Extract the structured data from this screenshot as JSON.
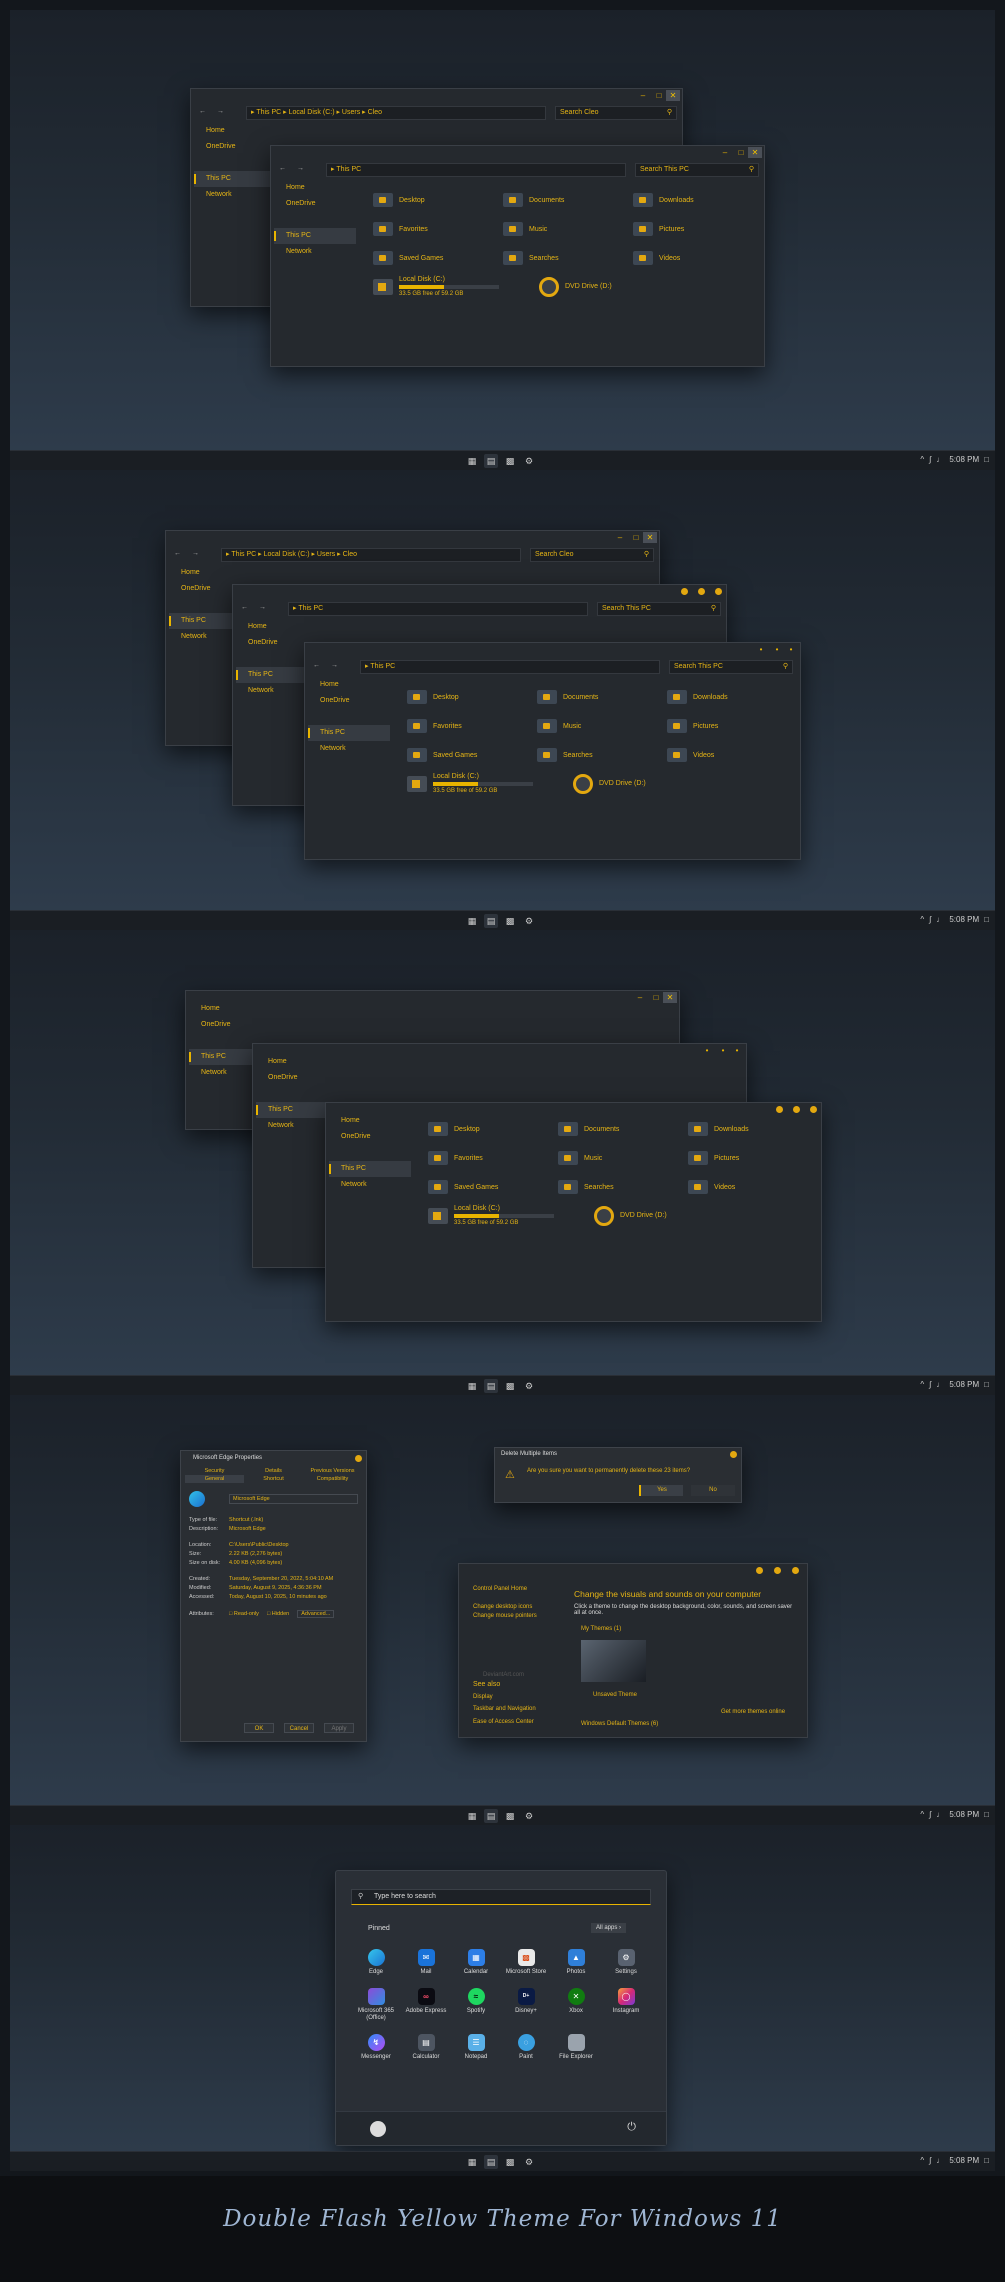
{
  "explorer": {
    "back": "←",
    "fwd": "→",
    "min": "–",
    "max": "□",
    "close": "✕",
    "path_long": "▸ This PC ▸ Local Disk (C:) ▸ Users ▸ Cleo",
    "path_short": "▸ This PC",
    "search_cleo": "Search Cleo",
    "search_pc": "Search This PC",
    "nav_home": "Home",
    "nav_onedrive": "OneDrive",
    "nav_thispc": "This PC",
    "nav_network": "Network",
    "folders": [
      "Desktop",
      "Documents",
      "Downloads",
      "Favorites",
      "Music",
      "Pictures",
      "Saved Games",
      "Searches",
      "Videos"
    ],
    "local_disk": "Local Disk (C:)",
    "local_disk_free": "33.5 GB free of 59.2 GB",
    "local_disk_used_fraction": 0.43,
    "dvd": "DVD Drive (D:)"
  },
  "taskbar": {
    "icons": [
      "taskview-icon",
      "explorer-icon",
      "store-icon",
      "settings-icon"
    ],
    "time": "5:08 PM"
  },
  "props": {
    "title": "Microsoft Edge Properties",
    "tabs": [
      "Security",
      "Details",
      "Previous Versions",
      "General",
      "Shortcut",
      "Compatibility"
    ],
    "name": "Microsoft Edge",
    "type_k": "Type of file:",
    "type_v": "Shortcut (.lnk)",
    "desc_k": "Description:",
    "desc_v": "Microsoft Edge",
    "loc_k": "Location:",
    "loc_v": "C:\\Users\\Public\\Desktop",
    "size_k": "Size:",
    "size_v": "2.22 KB (2,276 bytes)",
    "disk_k": "Size on disk:",
    "disk_v": "4.00 KB (4,096 bytes)",
    "cr_k": "Created:",
    "cr_v": "Tuesday, September 20, 2022, 5:04:10 AM",
    "mod_k": "Modified:",
    "mod_v": "Saturday, August 9, 2025, 4:36:36 PM",
    "acc_k": "Accessed:",
    "acc_v": "Today, August 10, 2025, 10 minutes ago",
    "attr_k": "Attributes:",
    "ro": "Read-only",
    "hidden": "Hidden",
    "adv": "Advanced...",
    "ok": "OK",
    "cancel": "Cancel",
    "apply": "Apply"
  },
  "delete": {
    "title": "Delete Multiple Items",
    "msg": "Are you sure you want to permanently delete these 23 items?",
    "yes": "Yes",
    "no": "No"
  },
  "cpanel": {
    "home": "Control Panel Home",
    "l1": "Change desktop icons",
    "l2": "Change mouse pointers",
    "watermark": "DeviantArt.com",
    "see": "See also",
    "s1": "Display",
    "s2": "Taskbar and Navigation",
    "s3": "Ease of Access Center",
    "h": "Change the visuals and sounds on your computer",
    "d": "Click a theme to change the desktop background, color, sounds, and screen saver all at once.",
    "mythemes": "My Themes (1)",
    "unsaved": "Unsaved Theme",
    "more": "Get more themes online",
    "defaults": "Windows Default Themes (6)"
  },
  "start": {
    "search": "Type here to search",
    "pinned": "Pinned",
    "all": "All apps",
    "apps": [
      "Edge",
      "Mail",
      "Calendar",
      "Microsoft Store",
      "Photos",
      "Settings",
      "Microsoft 365 (Office)",
      "Adobe Express",
      "Spotify",
      "Disney+",
      "Xbox",
      "Instagram",
      "Messenger",
      "Calculator",
      "Notepad",
      "Paint",
      "File Explorer"
    ]
  },
  "footer": {
    "title": "Double Flash Yellow Theme For Windows 11"
  },
  "colors": {
    "accent": "#e8b400",
    "window": "#25292e",
    "taskbar": "#1a1e23"
  }
}
